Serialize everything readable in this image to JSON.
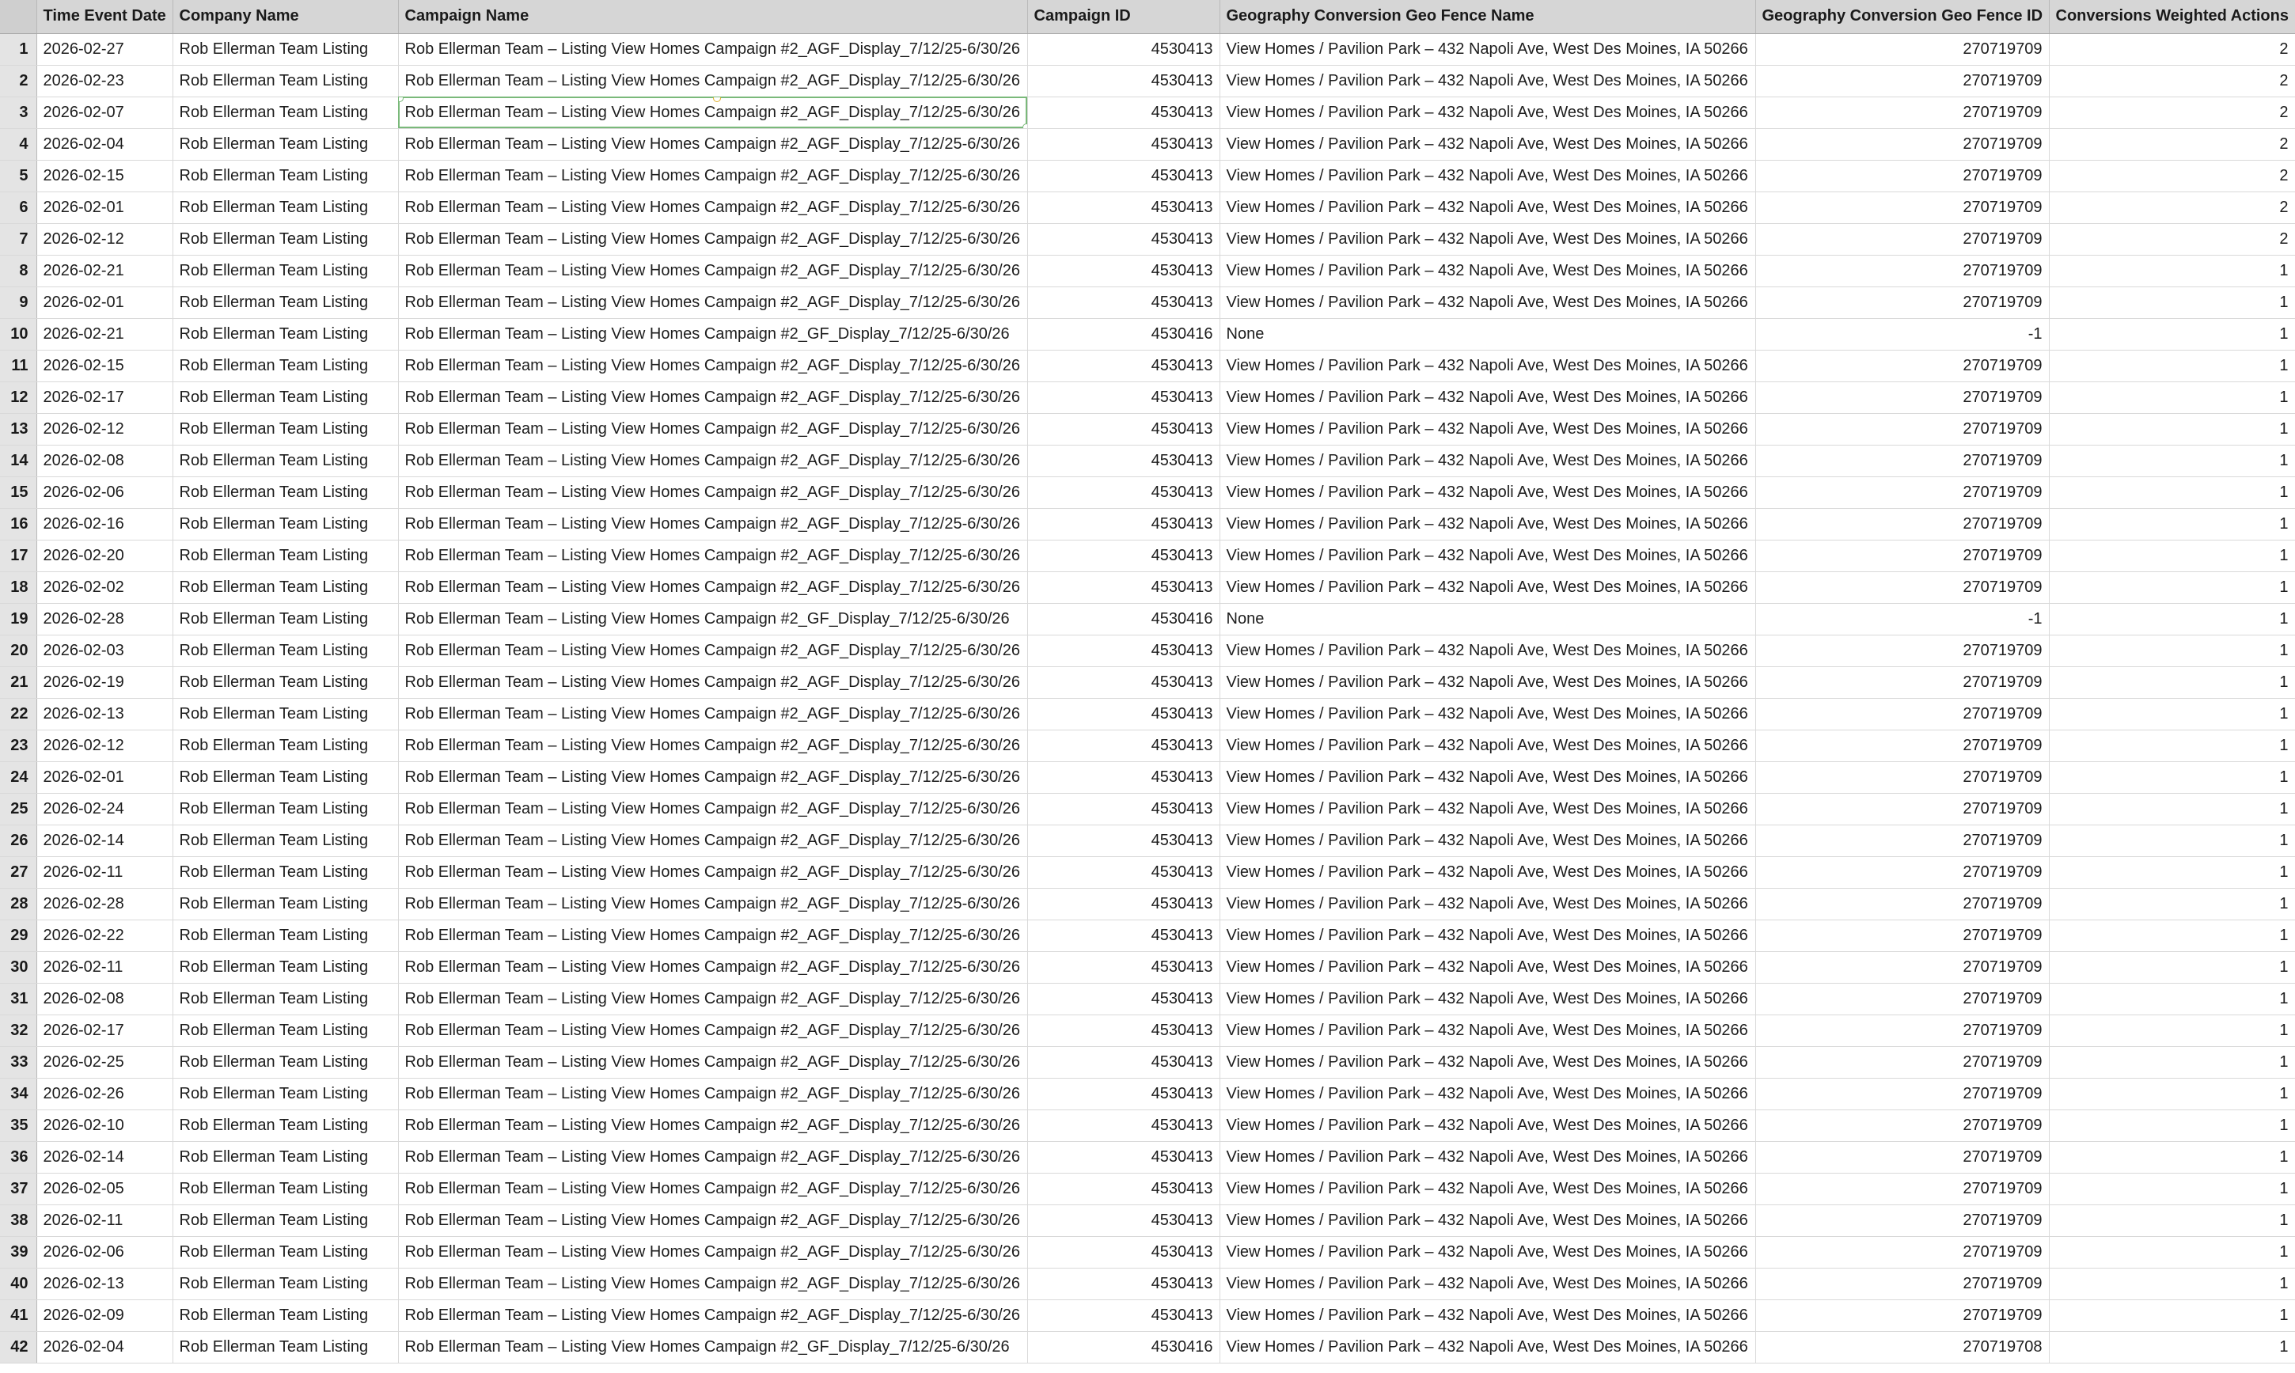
{
  "columns": [
    "Time Event Date",
    "Company Name",
    "Campaign Name",
    "Campaign ID",
    "Geography Conversion Geo Fence Name",
    "Geography Conversion Geo Fence ID",
    "Conversions Weighted Actions"
  ],
  "selected_row": 3,
  "rows": [
    {
      "n": "1",
      "date": "2026-02-27",
      "company": "Rob Ellerman Team Listing",
      "campaign": "Rob Ellerman Team – Listing View Homes Campaign #2_AGF_Display_7/12/25-6/30/26",
      "cid": "4530413",
      "geo": "View Homes / Pavilion Park – 432 Napoli Ave, West Des Moines, IA 50266",
      "gid": "270719709",
      "conv": "2"
    },
    {
      "n": "2",
      "date": "2026-02-23",
      "company": "Rob Ellerman Team Listing",
      "campaign": "Rob Ellerman Team – Listing View Homes Campaign #2_AGF_Display_7/12/25-6/30/26",
      "cid": "4530413",
      "geo": "View Homes / Pavilion Park – 432 Napoli Ave, West Des Moines, IA 50266",
      "gid": "270719709",
      "conv": "2"
    },
    {
      "n": "3",
      "date": "2026-02-07",
      "company": "Rob Ellerman Team Listing",
      "campaign": "Rob Ellerman Team – Listing View Homes Campaign #2_AGF_Display_7/12/25-6/30/26",
      "cid": "4530413",
      "geo": "View Homes / Pavilion Park – 432 Napoli Ave, West Des Moines, IA 50266",
      "gid": "270719709",
      "conv": "2"
    },
    {
      "n": "4",
      "date": "2026-02-04",
      "company": "Rob Ellerman Team Listing",
      "campaign": "Rob Ellerman Team – Listing View Homes Campaign #2_AGF_Display_7/12/25-6/30/26",
      "cid": "4530413",
      "geo": "View Homes / Pavilion Park – 432 Napoli Ave, West Des Moines, IA 50266",
      "gid": "270719709",
      "conv": "2"
    },
    {
      "n": "5",
      "date": "2026-02-15",
      "company": "Rob Ellerman Team Listing",
      "campaign": "Rob Ellerman Team – Listing View Homes Campaign #2_AGF_Display_7/12/25-6/30/26",
      "cid": "4530413",
      "geo": "View Homes / Pavilion Park – 432 Napoli Ave, West Des Moines, IA 50266",
      "gid": "270719709",
      "conv": "2"
    },
    {
      "n": "6",
      "date": "2026-02-01",
      "company": "Rob Ellerman Team Listing",
      "campaign": "Rob Ellerman Team – Listing View Homes Campaign #2_AGF_Display_7/12/25-6/30/26",
      "cid": "4530413",
      "geo": "View Homes / Pavilion Park – 432 Napoli Ave, West Des Moines, IA 50266",
      "gid": "270719709",
      "conv": "2"
    },
    {
      "n": "7",
      "date": "2026-02-12",
      "company": "Rob Ellerman Team Listing",
      "campaign": "Rob Ellerman Team – Listing View Homes Campaign #2_AGF_Display_7/12/25-6/30/26",
      "cid": "4530413",
      "geo": "View Homes / Pavilion Park – 432 Napoli Ave, West Des Moines, IA 50266",
      "gid": "270719709",
      "conv": "2"
    },
    {
      "n": "8",
      "date": "2026-02-21",
      "company": "Rob Ellerman Team Listing",
      "campaign": "Rob Ellerman Team – Listing View Homes Campaign #2_AGF_Display_7/12/25-6/30/26",
      "cid": "4530413",
      "geo": "View Homes / Pavilion Park – 432 Napoli Ave, West Des Moines, IA 50266",
      "gid": "270719709",
      "conv": "1"
    },
    {
      "n": "9",
      "date": "2026-02-01",
      "company": "Rob Ellerman Team Listing",
      "campaign": "Rob Ellerman Team – Listing View Homes Campaign #2_AGF_Display_7/12/25-6/30/26",
      "cid": "4530413",
      "geo": "View Homes / Pavilion Park – 432 Napoli Ave, West Des Moines, IA 50266",
      "gid": "270719709",
      "conv": "1"
    },
    {
      "n": "10",
      "date": "2026-02-21",
      "company": "Rob Ellerman Team Listing",
      "campaign": "Rob Ellerman Team – Listing View Homes Campaign #2_GF_Display_7/12/25-6/30/26",
      "cid": "4530416",
      "geo": "None",
      "gid": "-1",
      "conv": "1"
    },
    {
      "n": "11",
      "date": "2026-02-15",
      "company": "Rob Ellerman Team Listing",
      "campaign": "Rob Ellerman Team – Listing View Homes Campaign #2_AGF_Display_7/12/25-6/30/26",
      "cid": "4530413",
      "geo": "View Homes / Pavilion Park – 432 Napoli Ave, West Des Moines, IA 50266",
      "gid": "270719709",
      "conv": "1"
    },
    {
      "n": "12",
      "date": "2026-02-17",
      "company": "Rob Ellerman Team Listing",
      "campaign": "Rob Ellerman Team – Listing View Homes Campaign #2_AGF_Display_7/12/25-6/30/26",
      "cid": "4530413",
      "geo": "View Homes / Pavilion Park – 432 Napoli Ave, West Des Moines, IA 50266",
      "gid": "270719709",
      "conv": "1"
    },
    {
      "n": "13",
      "date": "2026-02-12",
      "company": "Rob Ellerman Team Listing",
      "campaign": "Rob Ellerman Team – Listing View Homes Campaign #2_AGF_Display_7/12/25-6/30/26",
      "cid": "4530413",
      "geo": "View Homes / Pavilion Park – 432 Napoli Ave, West Des Moines, IA 50266",
      "gid": "270719709",
      "conv": "1"
    },
    {
      "n": "14",
      "date": "2026-02-08",
      "company": "Rob Ellerman Team Listing",
      "campaign": "Rob Ellerman Team – Listing View Homes Campaign #2_AGF_Display_7/12/25-6/30/26",
      "cid": "4530413",
      "geo": "View Homes / Pavilion Park – 432 Napoli Ave, West Des Moines, IA 50266",
      "gid": "270719709",
      "conv": "1"
    },
    {
      "n": "15",
      "date": "2026-02-06",
      "company": "Rob Ellerman Team Listing",
      "campaign": "Rob Ellerman Team – Listing View Homes Campaign #2_AGF_Display_7/12/25-6/30/26",
      "cid": "4530413",
      "geo": "View Homes / Pavilion Park – 432 Napoli Ave, West Des Moines, IA 50266",
      "gid": "270719709",
      "conv": "1"
    },
    {
      "n": "16",
      "date": "2026-02-16",
      "company": "Rob Ellerman Team Listing",
      "campaign": "Rob Ellerman Team – Listing View Homes Campaign #2_AGF_Display_7/12/25-6/30/26",
      "cid": "4530413",
      "geo": "View Homes / Pavilion Park – 432 Napoli Ave, West Des Moines, IA 50266",
      "gid": "270719709",
      "conv": "1"
    },
    {
      "n": "17",
      "date": "2026-02-20",
      "company": "Rob Ellerman Team Listing",
      "campaign": "Rob Ellerman Team – Listing View Homes Campaign #2_AGF_Display_7/12/25-6/30/26",
      "cid": "4530413",
      "geo": "View Homes / Pavilion Park – 432 Napoli Ave, West Des Moines, IA 50266",
      "gid": "270719709",
      "conv": "1"
    },
    {
      "n": "18",
      "date": "2026-02-02",
      "company": "Rob Ellerman Team Listing",
      "campaign": "Rob Ellerman Team – Listing View Homes Campaign #2_AGF_Display_7/12/25-6/30/26",
      "cid": "4530413",
      "geo": "View Homes / Pavilion Park – 432 Napoli Ave, West Des Moines, IA 50266",
      "gid": "270719709",
      "conv": "1"
    },
    {
      "n": "19",
      "date": "2026-02-28",
      "company": "Rob Ellerman Team Listing",
      "campaign": "Rob Ellerman Team – Listing View Homes Campaign #2_GF_Display_7/12/25-6/30/26",
      "cid": "4530416",
      "geo": "None",
      "gid": "-1",
      "conv": "1"
    },
    {
      "n": "20",
      "date": "2026-02-03",
      "company": "Rob Ellerman Team Listing",
      "campaign": "Rob Ellerman Team – Listing View Homes Campaign #2_AGF_Display_7/12/25-6/30/26",
      "cid": "4530413",
      "geo": "View Homes / Pavilion Park – 432 Napoli Ave, West Des Moines, IA 50266",
      "gid": "270719709",
      "conv": "1"
    },
    {
      "n": "21",
      "date": "2026-02-19",
      "company": "Rob Ellerman Team Listing",
      "campaign": "Rob Ellerman Team – Listing View Homes Campaign #2_AGF_Display_7/12/25-6/30/26",
      "cid": "4530413",
      "geo": "View Homes / Pavilion Park – 432 Napoli Ave, West Des Moines, IA 50266",
      "gid": "270719709",
      "conv": "1"
    },
    {
      "n": "22",
      "date": "2026-02-13",
      "company": "Rob Ellerman Team Listing",
      "campaign": "Rob Ellerman Team – Listing View Homes Campaign #2_AGF_Display_7/12/25-6/30/26",
      "cid": "4530413",
      "geo": "View Homes / Pavilion Park – 432 Napoli Ave, West Des Moines, IA 50266",
      "gid": "270719709",
      "conv": "1"
    },
    {
      "n": "23",
      "date": "2026-02-12",
      "company": "Rob Ellerman Team Listing",
      "campaign": "Rob Ellerman Team – Listing View Homes Campaign #2_AGF_Display_7/12/25-6/30/26",
      "cid": "4530413",
      "geo": "View Homes / Pavilion Park – 432 Napoli Ave, West Des Moines, IA 50266",
      "gid": "270719709",
      "conv": "1"
    },
    {
      "n": "24",
      "date": "2026-02-01",
      "company": "Rob Ellerman Team Listing",
      "campaign": "Rob Ellerman Team – Listing View Homes Campaign #2_AGF_Display_7/12/25-6/30/26",
      "cid": "4530413",
      "geo": "View Homes / Pavilion Park – 432 Napoli Ave, West Des Moines, IA 50266",
      "gid": "270719709",
      "conv": "1"
    },
    {
      "n": "25",
      "date": "2026-02-24",
      "company": "Rob Ellerman Team Listing",
      "campaign": "Rob Ellerman Team – Listing View Homes Campaign #2_AGF_Display_7/12/25-6/30/26",
      "cid": "4530413",
      "geo": "View Homes / Pavilion Park – 432 Napoli Ave, West Des Moines, IA 50266",
      "gid": "270719709",
      "conv": "1"
    },
    {
      "n": "26",
      "date": "2026-02-14",
      "company": "Rob Ellerman Team Listing",
      "campaign": "Rob Ellerman Team – Listing View Homes Campaign #2_AGF_Display_7/12/25-6/30/26",
      "cid": "4530413",
      "geo": "View Homes / Pavilion Park – 432 Napoli Ave, West Des Moines, IA 50266",
      "gid": "270719709",
      "conv": "1"
    },
    {
      "n": "27",
      "date": "2026-02-11",
      "company": "Rob Ellerman Team Listing",
      "campaign": "Rob Ellerman Team – Listing View Homes Campaign #2_AGF_Display_7/12/25-6/30/26",
      "cid": "4530413",
      "geo": "View Homes / Pavilion Park – 432 Napoli Ave, West Des Moines, IA 50266",
      "gid": "270719709",
      "conv": "1"
    },
    {
      "n": "28",
      "date": "2026-02-28",
      "company": "Rob Ellerman Team Listing",
      "campaign": "Rob Ellerman Team – Listing View Homes Campaign #2_AGF_Display_7/12/25-6/30/26",
      "cid": "4530413",
      "geo": "View Homes / Pavilion Park – 432 Napoli Ave, West Des Moines, IA 50266",
      "gid": "270719709",
      "conv": "1"
    },
    {
      "n": "29",
      "date": "2026-02-22",
      "company": "Rob Ellerman Team Listing",
      "campaign": "Rob Ellerman Team – Listing View Homes Campaign #2_AGF_Display_7/12/25-6/30/26",
      "cid": "4530413",
      "geo": "View Homes / Pavilion Park – 432 Napoli Ave, West Des Moines, IA 50266",
      "gid": "270719709",
      "conv": "1"
    },
    {
      "n": "30",
      "date": "2026-02-11",
      "company": "Rob Ellerman Team Listing",
      "campaign": "Rob Ellerman Team – Listing View Homes Campaign #2_AGF_Display_7/12/25-6/30/26",
      "cid": "4530413",
      "geo": "View Homes / Pavilion Park – 432 Napoli Ave, West Des Moines, IA 50266",
      "gid": "270719709",
      "conv": "1"
    },
    {
      "n": "31",
      "date": "2026-02-08",
      "company": "Rob Ellerman Team Listing",
      "campaign": "Rob Ellerman Team – Listing View Homes Campaign #2_AGF_Display_7/12/25-6/30/26",
      "cid": "4530413",
      "geo": "View Homes / Pavilion Park – 432 Napoli Ave, West Des Moines, IA 50266",
      "gid": "270719709",
      "conv": "1"
    },
    {
      "n": "32",
      "date": "2026-02-17",
      "company": "Rob Ellerman Team Listing",
      "campaign": "Rob Ellerman Team – Listing View Homes Campaign #2_AGF_Display_7/12/25-6/30/26",
      "cid": "4530413",
      "geo": "View Homes / Pavilion Park – 432 Napoli Ave, West Des Moines, IA 50266",
      "gid": "270719709",
      "conv": "1"
    },
    {
      "n": "33",
      "date": "2026-02-25",
      "company": "Rob Ellerman Team Listing",
      "campaign": "Rob Ellerman Team – Listing View Homes Campaign #2_AGF_Display_7/12/25-6/30/26",
      "cid": "4530413",
      "geo": "View Homes / Pavilion Park – 432 Napoli Ave, West Des Moines, IA 50266",
      "gid": "270719709",
      "conv": "1"
    },
    {
      "n": "34",
      "date": "2026-02-26",
      "company": "Rob Ellerman Team Listing",
      "campaign": "Rob Ellerman Team – Listing View Homes Campaign #2_AGF_Display_7/12/25-6/30/26",
      "cid": "4530413",
      "geo": "View Homes / Pavilion Park – 432 Napoli Ave, West Des Moines, IA 50266",
      "gid": "270719709",
      "conv": "1"
    },
    {
      "n": "35",
      "date": "2026-02-10",
      "company": "Rob Ellerman Team Listing",
      "campaign": "Rob Ellerman Team – Listing View Homes Campaign #2_AGF_Display_7/12/25-6/30/26",
      "cid": "4530413",
      "geo": "View Homes / Pavilion Park – 432 Napoli Ave, West Des Moines, IA 50266",
      "gid": "270719709",
      "conv": "1"
    },
    {
      "n": "36",
      "date": "2026-02-14",
      "company": "Rob Ellerman Team Listing",
      "campaign": "Rob Ellerman Team – Listing View Homes Campaign #2_AGF_Display_7/12/25-6/30/26",
      "cid": "4530413",
      "geo": "View Homes / Pavilion Park – 432 Napoli Ave, West Des Moines, IA 50266",
      "gid": "270719709",
      "conv": "1"
    },
    {
      "n": "37",
      "date": "2026-02-05",
      "company": "Rob Ellerman Team Listing",
      "campaign": "Rob Ellerman Team – Listing View Homes Campaign #2_AGF_Display_7/12/25-6/30/26",
      "cid": "4530413",
      "geo": "View Homes / Pavilion Park – 432 Napoli Ave, West Des Moines, IA 50266",
      "gid": "270719709",
      "conv": "1"
    },
    {
      "n": "38",
      "date": "2026-02-11",
      "company": "Rob Ellerman Team Listing",
      "campaign": "Rob Ellerman Team – Listing View Homes Campaign #2_AGF_Display_7/12/25-6/30/26",
      "cid": "4530413",
      "geo": "View Homes / Pavilion Park – 432 Napoli Ave, West Des Moines, IA 50266",
      "gid": "270719709",
      "conv": "1"
    },
    {
      "n": "39",
      "date": "2026-02-06",
      "company": "Rob Ellerman Team Listing",
      "campaign": "Rob Ellerman Team – Listing View Homes Campaign #2_AGF_Display_7/12/25-6/30/26",
      "cid": "4530413",
      "geo": "View Homes / Pavilion Park – 432 Napoli Ave, West Des Moines, IA 50266",
      "gid": "270719709",
      "conv": "1"
    },
    {
      "n": "40",
      "date": "2026-02-13",
      "company": "Rob Ellerman Team Listing",
      "campaign": "Rob Ellerman Team – Listing View Homes Campaign #2_AGF_Display_7/12/25-6/30/26",
      "cid": "4530413",
      "geo": "View Homes / Pavilion Park – 432 Napoli Ave, West Des Moines, IA 50266",
      "gid": "270719709",
      "conv": "1"
    },
    {
      "n": "41",
      "date": "2026-02-09",
      "company": "Rob Ellerman Team Listing",
      "campaign": "Rob Ellerman Team – Listing View Homes Campaign #2_AGF_Display_7/12/25-6/30/26",
      "cid": "4530413",
      "geo": "View Homes / Pavilion Park – 432 Napoli Ave, West Des Moines, IA 50266",
      "gid": "270719709",
      "conv": "1"
    },
    {
      "n": "42",
      "date": "2026-02-04",
      "company": "Rob Ellerman Team Listing",
      "campaign": "Rob Ellerman Team – Listing View Homes Campaign #2_GF_Display_7/12/25-6/30/26",
      "cid": "4530416",
      "geo": "View Homes / Pavilion Park – 432 Napoli Ave, West Des Moines, IA 50266",
      "gid": "270719708",
      "conv": "1"
    }
  ]
}
